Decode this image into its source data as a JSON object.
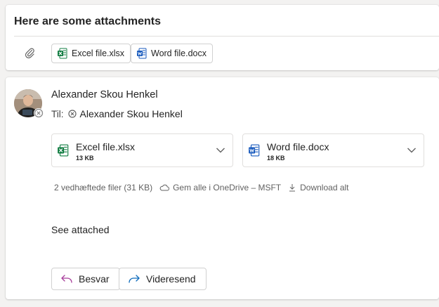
{
  "top": {
    "subject": "Here are some attachments",
    "chips": [
      {
        "name": "Excel file.xlsx",
        "type": "excel"
      },
      {
        "name": "Word file.docx",
        "type": "word"
      }
    ]
  },
  "mail": {
    "sender": "Alexander Skou Henkel",
    "to_label": "Til:",
    "recipient": "Alexander Skou Henkel",
    "attachments": [
      {
        "name": "Excel file.xlsx",
        "size": "13 KB",
        "type": "excel"
      },
      {
        "name": "Word file.docx",
        "size": "18 KB",
        "type": "word"
      }
    ],
    "attachment_summary": "2 vedhæftede filer (31 KB)",
    "save_all": "Gem alle i OneDrive – MSFT",
    "download_all": "Download alt",
    "body": "See attached",
    "reply": "Besvar",
    "forward": "Videresend"
  },
  "colors": {
    "excel": "#107c41",
    "word": "#185abd",
    "reply_icon": "#a83f9b",
    "forward_icon": "#0f6cbd"
  }
}
